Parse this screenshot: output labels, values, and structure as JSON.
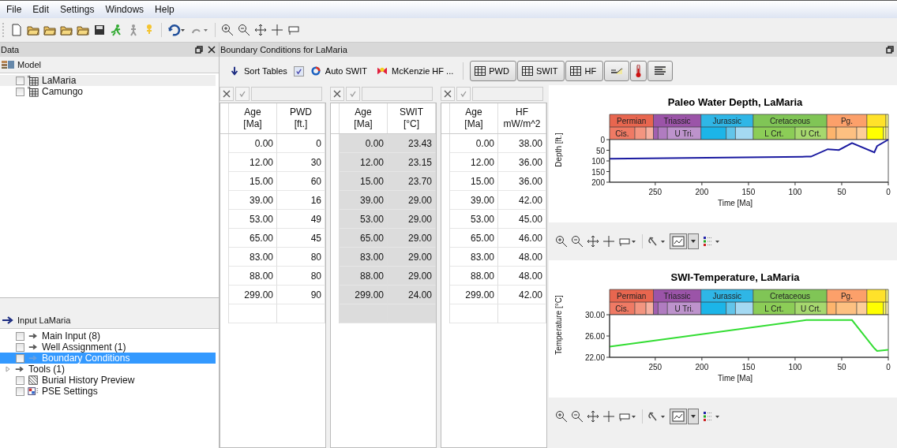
{
  "menu": [
    "File",
    "Edit",
    "Settings",
    "Windows",
    "Help"
  ],
  "data_panel": {
    "title": "Data",
    "model": {
      "title": "Model",
      "items": [
        {
          "label": "LaMaria",
          "checked": false,
          "selected": true
        },
        {
          "label": "Camungo",
          "checked": false,
          "selected": false
        }
      ]
    },
    "input": {
      "title": "Input LaMaria",
      "items": [
        {
          "kind": "arrow",
          "label": "Main Input (8)",
          "checked": false,
          "selected": false
        },
        {
          "kind": "arrow",
          "label": "Well Assignment (1)",
          "checked": false,
          "selected": false
        },
        {
          "kind": "arrow",
          "label": "Boundary Conditions",
          "checked": false,
          "selected": true
        },
        {
          "kind": "group",
          "label": "Tools (1)",
          "expanded": false,
          "selected": false
        },
        {
          "kind": "burial",
          "label": "Burial History Preview",
          "checked": false,
          "selected": false
        },
        {
          "kind": "pse",
          "label": "PSE Settings",
          "checked": false,
          "selected": false
        }
      ]
    }
  },
  "editor": {
    "title": "Boundary Conditions for LaMaria",
    "toolbar": {
      "sort": "Sort Tables",
      "auto_swit": {
        "label": "Auto SWIT",
        "checked": true
      },
      "mckenzie": "McKenzie HF ...",
      "tables": [
        "PWD",
        "SWIT",
        "HF"
      ]
    },
    "tables": [
      {
        "readonly": false,
        "columns": [
          {
            "name": "Age",
            "unit": "[Ma]"
          },
          {
            "name": "PWD",
            "unit": "[ft.]"
          }
        ],
        "rows": [
          [
            "0.00",
            "0"
          ],
          [
            "12.00",
            "30"
          ],
          [
            "15.00",
            "60"
          ],
          [
            "39.00",
            "16"
          ],
          [
            "53.00",
            "49"
          ],
          [
            "65.00",
            "45"
          ],
          [
            "83.00",
            "80"
          ],
          [
            "88.00",
            "80"
          ],
          [
            "299.00",
            "90"
          ]
        ]
      },
      {
        "readonly": true,
        "columns": [
          {
            "name": "Age",
            "unit": "[Ma]"
          },
          {
            "name": "SWIT",
            "unit": "[°C]"
          }
        ],
        "rows": [
          [
            "0.00",
            "23.43"
          ],
          [
            "12.00",
            "23.15"
          ],
          [
            "15.00",
            "23.70"
          ],
          [
            "39.00",
            "29.00"
          ],
          [
            "53.00",
            "29.00"
          ],
          [
            "65.00",
            "29.00"
          ],
          [
            "83.00",
            "29.00"
          ],
          [
            "88.00",
            "29.00"
          ],
          [
            "299.00",
            "24.00"
          ]
        ]
      },
      {
        "readonly": false,
        "columns": [
          {
            "name": "Age",
            "unit": "[Ma]"
          },
          {
            "name": "HF",
            "unit": "mW/m^2"
          }
        ],
        "rows": [
          [
            "0.00",
            "38.00"
          ],
          [
            "12.00",
            "36.00"
          ],
          [
            "15.00",
            "36.00"
          ],
          [
            "39.00",
            "42.00"
          ],
          [
            "53.00",
            "45.00"
          ],
          [
            "65.00",
            "46.00"
          ],
          [
            "83.00",
            "48.00"
          ],
          [
            "88.00",
            "48.00"
          ],
          [
            "299.00",
            "42.00"
          ]
        ]
      }
    ],
    "charts": [
      {
        "chart_data": {
          "type": "line",
          "title": "Paleo Water Depth, LaMaria",
          "xlabel": "Time [Ma]",
          "ylabel": "Depth [ft.]",
          "x": [
            0,
            12,
            15,
            39,
            53,
            65,
            83,
            88,
            299
          ],
          "series": [
            {
              "color": "#1a1aa0",
              "values": [
                0,
                30,
                60,
                16,
                49,
                45,
                80,
                80,
                90
              ]
            }
          ],
          "xlim": [
            299,
            0
          ],
          "ylim": [
            200,
            0
          ],
          "xticks": [
            250,
            200,
            150,
            100,
            50,
            0
          ],
          "yticks": [
            0,
            50,
            100,
            150,
            200
          ]
        },
        "time_scale": {
          "periods": [
            {
              "label": "Permian",
              "color": "#e8664f"
            },
            {
              "label": "Triassic",
              "color": "#9b54a8"
            },
            {
              "label": "Jurassic",
              "color": "#2fb6e6"
            },
            {
              "label": "Cretaceous",
              "color": "#80c556"
            },
            {
              "label": "Pg.",
              "color": "#fca06a"
            },
            {
              "color": "#ffe22a"
            },
            {
              "color": "#f9f97f"
            }
          ],
          "epochs": [
            {
              "label": "Cis.",
              "color": "#ef7a64"
            },
            {
              "color": "#f39580"
            },
            {
              "color": "#f6b0a0"
            },
            {
              "color": "#a160b0"
            },
            {
              "color": "#b07cc0"
            },
            {
              "label": "U Tri.",
              "color": "#bd93cc"
            },
            {
              "color": "#1cb5e8"
            },
            {
              "color": "#62c5ea"
            },
            {
              "color": "#a4d9f2"
            },
            {
              "label": "L Crt.",
              "color": "#8ccd57"
            },
            {
              "label": "U Crt.",
              "color": "#a6d86e"
            },
            {
              "color": "#fdb46c"
            },
            {
              "color": "#fdc081"
            },
            {
              "color": "#fdcd99"
            },
            {
              "color": "#ffff00"
            },
            {
              "color": "#ffff66"
            },
            {
              "color": "#fef2b0"
            }
          ]
        }
      },
      {
        "chart_data": {
          "type": "line",
          "title": "SWI-Temperature, LaMaria",
          "xlabel": "Time [Ma]",
          "ylabel": "Temperature [°C]",
          "x": [
            0,
            12,
            15,
            39,
            53,
            65,
            83,
            88,
            299
          ],
          "series": [
            {
              "color": "#33dd33",
              "values": [
                23.4,
                23.2,
                23.7,
                29,
                29,
                29,
                29,
                29,
                24
              ]
            }
          ],
          "xlim": [
            299,
            0
          ],
          "ylim": [
            22,
            30
          ],
          "xticks": [
            250,
            200,
            150,
            100,
            50,
            0
          ],
          "yticks": [
            {
              "value": 22,
              "label": "22.00"
            },
            {
              "value": 26,
              "label": "26.00"
            },
            {
              "value": 30,
              "label": "30.00"
            }
          ]
        },
        "time_scale": {
          "periods": [
            {
              "label": "Permian",
              "color": "#e8664f"
            },
            {
              "label": "Triassic",
              "color": "#9b54a8"
            },
            {
              "label": "Jurassic",
              "color": "#2fb6e6"
            },
            {
              "label": "Cretaceous",
              "color": "#80c556"
            },
            {
              "label": "Pg.",
              "color": "#fca06a"
            },
            {
              "color": "#ffe22a"
            },
            {
              "color": "#f9f97f"
            }
          ],
          "epochs": [
            {
              "label": "Cis.",
              "color": "#ef7a64"
            },
            {
              "color": "#f39580"
            },
            {
              "color": "#f6b0a0"
            },
            {
              "color": "#a160b0"
            },
            {
              "color": "#b07cc0"
            },
            {
              "label": "U Tri.",
              "color": "#bd93cc"
            },
            {
              "color": "#1cb5e8"
            },
            {
              "color": "#62c5ea"
            },
            {
              "color": "#a4d9f2"
            },
            {
              "label": "L Crt.",
              "color": "#8ccd57"
            },
            {
              "label": "U Crt.",
              "color": "#a6d86e"
            },
            {
              "color": "#fdb46c"
            },
            {
              "color": "#fdc081"
            },
            {
              "color": "#fdcd99"
            },
            {
              "color": "#ffff00"
            },
            {
              "color": "#ffff66"
            },
            {
              "color": "#fef2b0"
            }
          ]
        }
      }
    ]
  }
}
